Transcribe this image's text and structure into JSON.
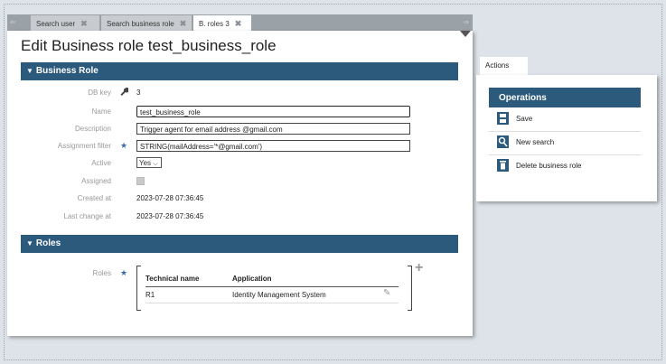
{
  "tabs": [
    {
      "label": "Search user",
      "active": false
    },
    {
      "label": "Search business role",
      "active": false
    },
    {
      "label": "B. roles 3",
      "active": true
    }
  ],
  "tab_close_glyph": "✖",
  "page_title": "Edit Business role test_business_role",
  "sections": {
    "business_role": "Business Role",
    "roles": "Roles"
  },
  "fields": {
    "db_key": {
      "label": "DB key",
      "value": "3"
    },
    "name": {
      "label": "Name",
      "value": "test_business_role"
    },
    "description": {
      "label": "Description",
      "value": "Trigger agent for email address @gmail.com"
    },
    "assignment_filter": {
      "label": "Assignment filter",
      "value": "STRING(mailAddress='*@gmail.com')"
    },
    "active": {
      "label": "Active",
      "value": "Yes"
    },
    "assigned": {
      "label": "Assigned",
      "checked": false
    },
    "created_at": {
      "label": "Created at",
      "value": "2023-07-28 07:36:45"
    },
    "last_change_at": {
      "label": "Last change at",
      "value": "2023-07-28 07:36:45"
    }
  },
  "roles_table": {
    "label": "Roles",
    "columns": [
      "Technical name",
      "Application"
    ],
    "rows": [
      {
        "technical_name": "R1",
        "application": "Identity Management System"
      }
    ]
  },
  "actions": {
    "tab_label": "Actions",
    "operations_title": "Operations",
    "items": [
      {
        "label": "Save",
        "icon": "save-icon"
      },
      {
        "label": "New search",
        "icon": "search-icon"
      },
      {
        "label": "Delete business role",
        "icon": "trash-icon"
      }
    ]
  },
  "colors": {
    "section_bar": "#2b5a7c",
    "required_marker": "#3b6ea5",
    "background": "#dde3e8"
  }
}
